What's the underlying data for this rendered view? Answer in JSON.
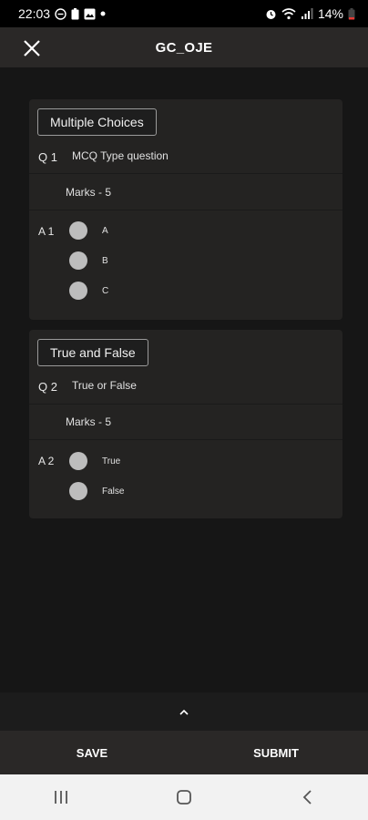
{
  "status_bar": {
    "time": "22:03",
    "battery": "14%",
    "icons_left": [
      "dnd-icon",
      "battery-saver-icon",
      "image-icon",
      "dot-icon"
    ],
    "icons_right": [
      "alarm-icon",
      "wifi-icon",
      "signal-icon",
      "battery-icon"
    ]
  },
  "app_bar": {
    "title": "GC_OJE",
    "close_icon": "close-icon"
  },
  "sections": [
    {
      "chip": "Multiple Choices",
      "question_number": "Q 1",
      "question_text": "MCQ Type question",
      "marks": "Marks - 5",
      "answer_number": "A 1",
      "options": [
        "A",
        "B",
        "C"
      ]
    },
    {
      "chip": "True and False",
      "question_number": "Q 2",
      "question_text": "True or False",
      "marks": "Marks - 5",
      "answer_number": "A 2",
      "options": [
        "True",
        "False"
      ]
    }
  ],
  "expand_icon": "chevron-up-icon",
  "actions": {
    "save": "SAVE",
    "submit": "SUBMIT"
  },
  "nav": {
    "recent": "recent-apps-icon",
    "home": "home-icon",
    "back": "back-icon"
  },
  "colors": {
    "background": "#161616",
    "card": "#242322",
    "bar": "#2a2827",
    "radio": "#bdbdbd"
  }
}
